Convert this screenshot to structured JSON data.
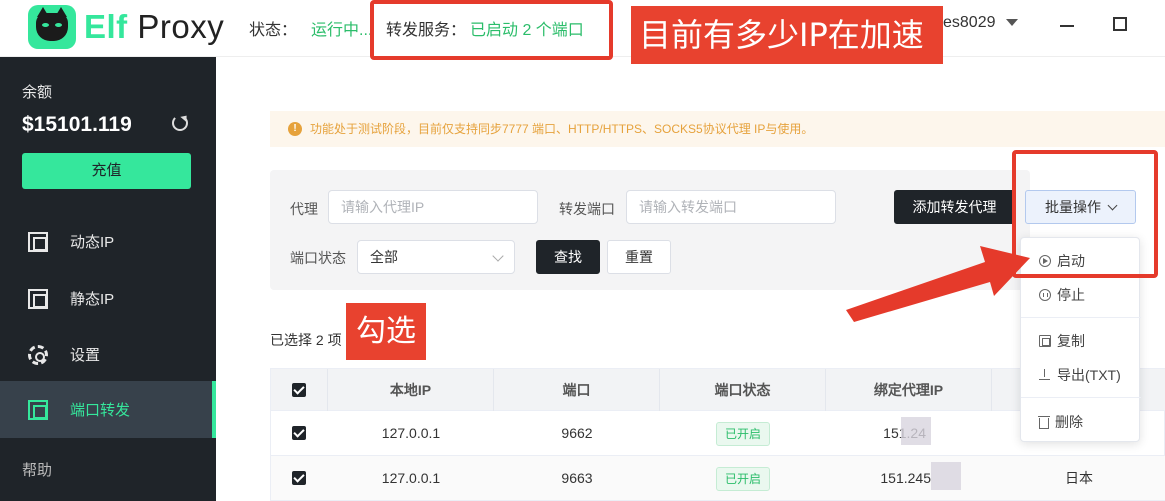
{
  "header": {
    "brand_prefix": "Elf",
    "brand_suffix": "Proxy",
    "status_label": "状态：",
    "status_value": "运行中...",
    "forward_label": "转发服务：",
    "forward_value": "已启动 2 个端口",
    "user": "es8029"
  },
  "annotations": {
    "ip_question": "目前有多少IP在加速",
    "check_hint": "勾选"
  },
  "sidebar": {
    "balance_label": "余额",
    "balance_value": "$15101.119",
    "recharge_label": "充值",
    "items": [
      {
        "label": "动态IP",
        "icon": "proxy-icon"
      },
      {
        "label": "静态IP",
        "icon": "building-icon"
      },
      {
        "label": "设置",
        "icon": "gear-icon"
      },
      {
        "label": "端口转发",
        "icon": "forward-icon",
        "active": true
      }
    ],
    "help_label": "帮助"
  },
  "notice": {
    "text": "功能处于测试阶段，目前仅支持同步7777 端口、HTTP/HTTPS、SOCKS5协议代理 IP与使用。"
  },
  "filter": {
    "proxy_label": "代理",
    "proxy_placeholder": "请输入代理IP",
    "port_label": "转发端口",
    "port_placeholder": "请输入转发端口",
    "status_label": "端口状态",
    "status_value": "全部",
    "search_label": "查找",
    "reset_label": "重置",
    "add_label": "添加转发代理",
    "batch_label": "批量操作"
  },
  "batch_menu": {
    "start": "启动",
    "stop": "停止",
    "copy": "复制",
    "export": "导出(TXT)",
    "delete": "删除"
  },
  "selection": {
    "text": "已选择 2 项"
  },
  "table": {
    "columns": [
      "本地IP",
      "端口",
      "端口状态",
      "绑定代理IP"
    ],
    "rows": [
      {
        "local_ip": "127.0.0.1",
        "port": "9662",
        "status": "已开启",
        "proxy_ip": "151.24",
        "checked": true
      },
      {
        "local_ip": "127.0.0.1",
        "port": "9663",
        "status": "已开启",
        "proxy_ip": "151.245",
        "country": "日本",
        "checked": true
      }
    ]
  },
  "colors": {
    "brand": "#35e79c",
    "annotation_red": "#e8422f",
    "sidebar_bg": "#1f2429",
    "success": "#2bbd6a"
  }
}
